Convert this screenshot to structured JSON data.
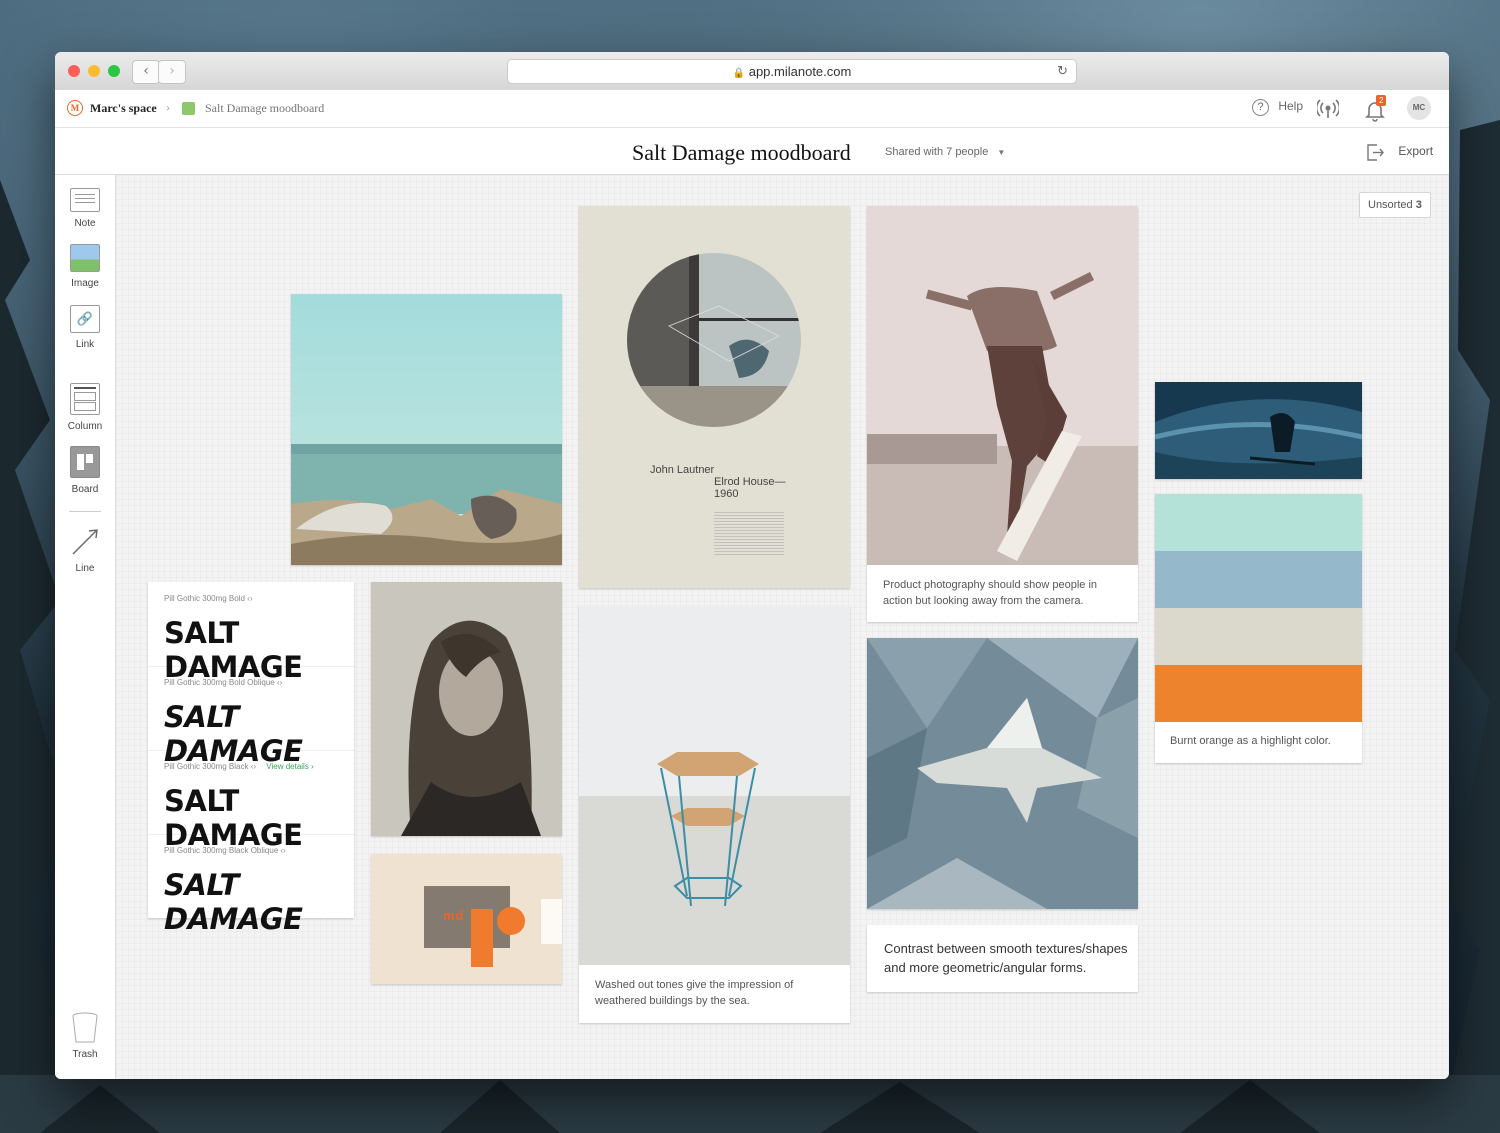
{
  "browser": {
    "url": "app.milanote.com"
  },
  "breadcrumb": {
    "space": "Marc's space",
    "board": "Salt Damage moodboard"
  },
  "header": {
    "help": "Help",
    "notification_count": "2",
    "avatar": "MC",
    "title": "Salt Damage moodboard",
    "shared": "Shared with 7 people",
    "export": "Export"
  },
  "tools": [
    {
      "label": "Note",
      "icon": "note-icon"
    },
    {
      "label": "Image",
      "icon": "image-icon"
    },
    {
      "label": "Link",
      "icon": "link-icon"
    },
    {
      "label": "Column",
      "icon": "column-icon"
    },
    {
      "label": "Board",
      "icon": "board-icon"
    },
    {
      "label": "Line",
      "icon": "line-icon"
    },
    {
      "label": "Trash",
      "icon": "trash-icon"
    }
  ],
  "unsorted": {
    "label": "Unsorted",
    "count": "3"
  },
  "fonts": [
    {
      "meta": "Pill Gothic 300mg Bold",
      "sample": "SALT DAMAGE",
      "link": ""
    },
    {
      "meta": "Pill Gothic 300mg Bold Oblique",
      "sample": "SALT DAMAGE",
      "link": ""
    },
    {
      "meta": "Pill Gothic 300mg Black",
      "sample": "SALT DAMAGE",
      "link": "View details ›"
    },
    {
      "meta": "Pill Gothic 300mg Black Oblique",
      "sample": "SALT DAMAGE",
      "link": ""
    }
  ],
  "poster": {
    "line1": "John Lautner",
    "line2": "Elrod House—",
    "line3": "1960"
  },
  "poster_logo": "md",
  "captions": {
    "skater": "Product photography should show people in action but looking away from the camera.",
    "stool": "Washed out tones give the impression of weathered buildings by the sea.",
    "contrast": "Contrast between smooth textures/shapes and more geometric/angular forms.",
    "palette": "Burnt orange as a highlight color."
  },
  "palette": [
    "#b4e2d9",
    "#95b8cb",
    "#dbd9cc",
    "#ed832d"
  ],
  "colors": {
    "accent": "#e8652b",
    "board_swatch": "#8dc86e",
    "link_green": "#3aa35b"
  }
}
